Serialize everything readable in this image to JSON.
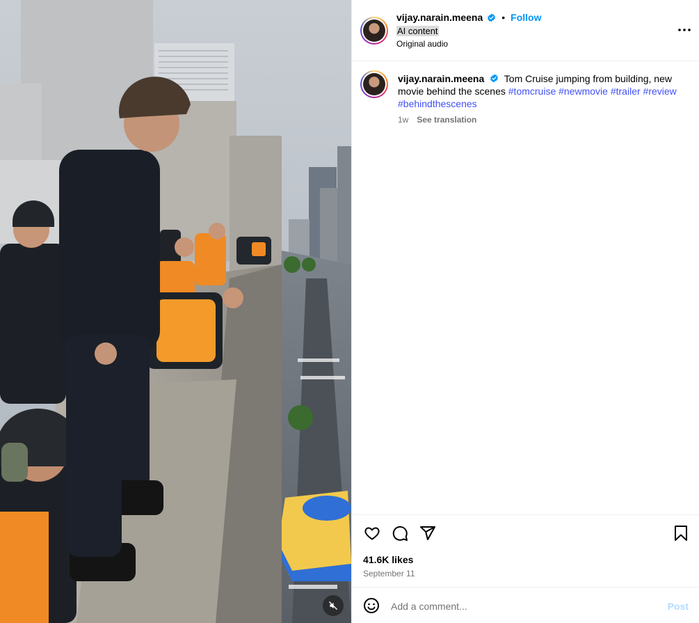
{
  "media": {
    "type": "video",
    "mute_icon": "speaker-muted-icon"
  },
  "header": {
    "username": "vijay.narain.meena",
    "verified_icon": "verified-badge-icon",
    "separator": "•",
    "follow_label": "Follow",
    "ai_label": "AI content",
    "audio_label": "Original audio",
    "more_icon": "more-options-icon"
  },
  "caption": {
    "username": "vijay.narain.meena",
    "text": "Tom Cruise jumping from building, new movie behind the scenes",
    "hashtags": [
      "#tomcruise",
      "#newmovie",
      "#trailer",
      "#review",
      "#behindthescenes"
    ],
    "time": "1w",
    "see_translation": "See translation"
  },
  "actions": {
    "like_icon": "heart-icon",
    "comment_icon": "comment-icon",
    "share_icon": "share-icon",
    "save_icon": "bookmark-icon",
    "likes": "41.6K likes",
    "date": "September 11"
  },
  "comment": {
    "emoji_icon": "emoji-icon",
    "placeholder": "Add a comment...",
    "post_label": "Post"
  },
  "colors": {
    "follow_blue": "#0095f6",
    "hashtag_blue": "#4150f7",
    "post_disabled": "#b3dbff",
    "meta_gray": "#737373",
    "divider": "#efefef"
  }
}
